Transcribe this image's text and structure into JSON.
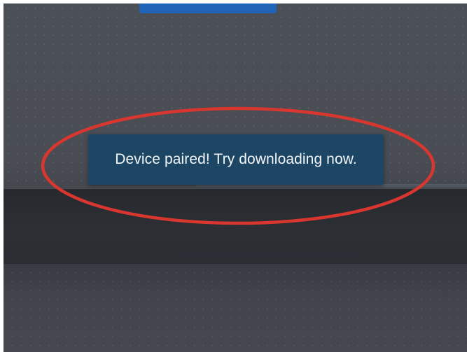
{
  "toast": {
    "message": "Device paired! Try downloading now."
  },
  "colors": {
    "background": "#4a4f55",
    "toast_background": "#1c4664",
    "toast_text": "#f3f6f9",
    "top_accent": "#1f64b6",
    "annotation_ring": "#d9362f"
  }
}
